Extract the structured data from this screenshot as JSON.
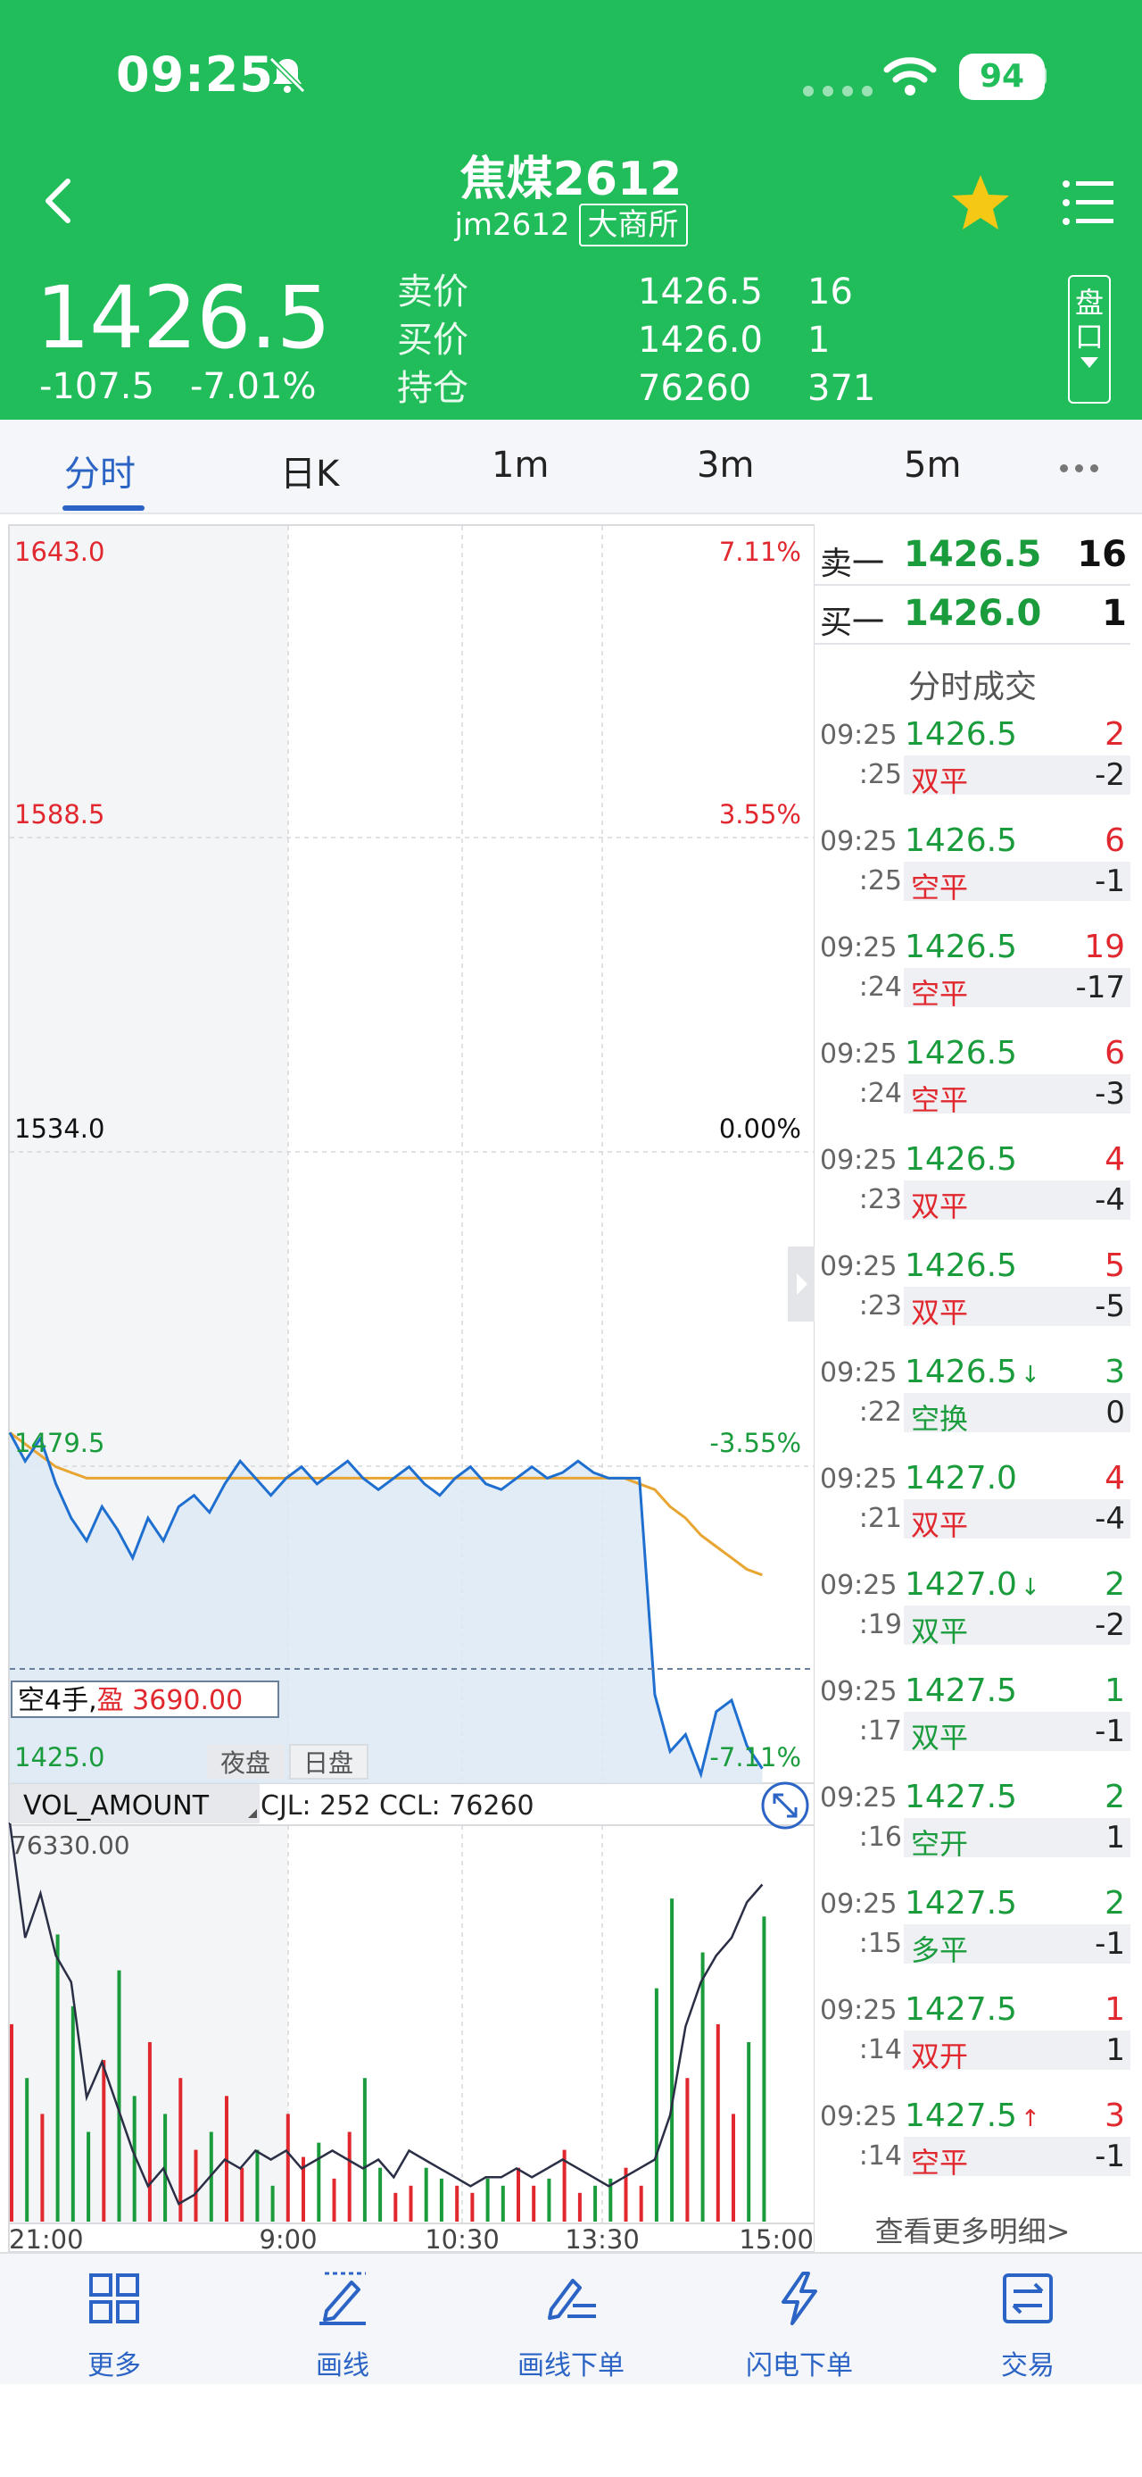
{
  "status_bar": {
    "time": "09:25",
    "battery": "94"
  },
  "header": {
    "name": "焦煤2612",
    "code": "jm2612",
    "exchange": "大商所",
    "last_price": "1426.5",
    "change": "-107.5",
    "change_pct": "-7.01%",
    "quote_rows": [
      {
        "label": "卖价",
        "value": "1426.5",
        "qty": "16"
      },
      {
        "label": "买价",
        "value": "1426.0",
        "qty": "1"
      },
      {
        "label": "持仓",
        "value": "76260",
        "qty": "371"
      }
    ],
    "panel_button": "盘口"
  },
  "tabs": [
    {
      "label": "分时",
      "active": true
    },
    {
      "label": "日K",
      "active": false
    },
    {
      "label": "1m",
      "active": false
    },
    {
      "label": "3m",
      "active": false
    },
    {
      "label": "5m",
      "active": false
    }
  ],
  "chart": {
    "price_labels": [
      "1643.0",
      "1588.5",
      "1534.0",
      "1479.5",
      "1425.0"
    ],
    "pct_labels": [
      "7.11%",
      "3.55%",
      "0.00%",
      "-3.55%",
      "-7.11%"
    ],
    "position_tag_left": "空4手,",
    "position_tag_right": "盈 3690.00",
    "session_night": "夜盘",
    "session_day": "日盘",
    "vol_indicator": "VOL_AMOUNT",
    "vol_info": "CJL: 252  CCL: 76260",
    "vol_max": "76330.00",
    "x_labels": [
      "21:00",
      "9:00",
      "10:30",
      "13:30",
      "15:00"
    ],
    "colors": {
      "price_line": "#1f6fd0",
      "avg_line": "#e8a532",
      "up": "#e0282e",
      "down": "#1a9c3d"
    }
  },
  "chart_data": {
    "type": "line",
    "title": "",
    "xlabel": "",
    "ylabel": "",
    "x_ticks": [
      "21:00",
      "9:00",
      "10:30",
      "13:30",
      "15:00"
    ],
    "ylim": [
      1425.0,
      1643.0
    ],
    "pct_range": [
      "-7.11%",
      "7.11%"
    ],
    "prev_settle": 1534.0,
    "series": [
      {
        "values": [
          1485,
          1480,
          1484,
          1476,
          1470,
          1466,
          1472,
          1468,
          1463,
          1470,
          1466,
          1472,
          1474,
          1471,
          1476,
          1480,
          1477,
          1474,
          1477,
          1479,
          1476,
          1478,
          1480,
          1477,
          1475,
          1477,
          1479,
          1476,
          1474,
          1477,
          1479,
          1476,
          1475,
          1477,
          1479,
          1477,
          1478,
          1480,
          1478,
          1477,
          1477,
          1477,
          1439,
          1429,
          1432,
          1425,
          1436,
          1438,
          1430,
          1426
        ]
      },
      {
        "values": [
          1485,
          1483,
          1481,
          1479,
          1478,
          1477,
          1477,
          1477,
          1477,
          1477,
          1477,
          1477,
          1477,
          1477,
          1477,
          1477,
          1477,
          1477,
          1477,
          1477,
          1477,
          1477,
          1477,
          1477,
          1477,
          1477,
          1477,
          1477,
          1477,
          1477,
          1477,
          1477,
          1477,
          1477,
          1477,
          1477,
          1477,
          1477,
          1477,
          1477,
          1477,
          1476,
          1475,
          1472,
          1470,
          1467,
          1465,
          1463,
          1461,
          1460
        ]
      }
    ],
    "volume": [
      55,
      40,
      30,
      80,
      60,
      25,
      45,
      70,
      35,
      50,
      30,
      40,
      20,
      25,
      35,
      15,
      20,
      10,
      30,
      18,
      22,
      12,
      25,
      40,
      15,
      8,
      10,
      15,
      12,
      10,
      8,
      12,
      10,
      15,
      10,
      12,
      20,
      8,
      10,
      12,
      15,
      10,
      65,
      90,
      40,
      75,
      55,
      30,
      50,
      85
    ],
    "open_interest": [
      76330,
      76200,
      76250,
      76180,
      76150,
      76020,
      76060,
      76010,
      75960,
      75920,
      75940,
      75900,
      75910,
      75930,
      75950,
      75940,
      75960,
      75950,
      75960,
      75940,
      75950,
      75960,
      75950,
      75940,
      75950,
      75930,
      75960,
      75950,
      75940,
      75930,
      75920,
      75930,
      75930,
      75940,
      75930,
      75940,
      75950,
      75940,
      75930,
      75920,
      75930,
      75940,
      75950,
      76000,
      76100,
      76150,
      76180,
      76200,
      76240,
      76260
    ],
    "position_line": 1443.5
  },
  "order_book": [
    {
      "label": "卖一",
      "price": "1426.5",
      "vol": "16"
    },
    {
      "label": "买一",
      "price": "1426.0",
      "vol": "1"
    }
  ],
  "trades_title": "分时成交",
  "trades": [
    {
      "t1": "09:25",
      "t2": ":25",
      "price": "1426.5",
      "arrow": "",
      "vol": "2",
      "vol_color": "red",
      "type": "双平",
      "type_color": "red",
      "chg": "-2"
    },
    {
      "t1": "09:25",
      "t2": ":25",
      "price": "1426.5",
      "arrow": "",
      "vol": "6",
      "vol_color": "red",
      "type": "空平",
      "type_color": "red",
      "chg": "-1"
    },
    {
      "t1": "09:25",
      "t2": ":24",
      "price": "1426.5",
      "arrow": "",
      "vol": "19",
      "vol_color": "red",
      "type": "空平",
      "type_color": "red",
      "chg": "-17"
    },
    {
      "t1": "09:25",
      "t2": ":24",
      "price": "1426.5",
      "arrow": "",
      "vol": "6",
      "vol_color": "red",
      "type": "空平",
      "type_color": "red",
      "chg": "-3"
    },
    {
      "t1": "09:25",
      "t2": ":23",
      "price": "1426.5",
      "arrow": "",
      "vol": "4",
      "vol_color": "red",
      "type": "双平",
      "type_color": "red",
      "chg": "-4"
    },
    {
      "t1": "09:25",
      "t2": ":23",
      "price": "1426.5",
      "arrow": "",
      "vol": "5",
      "vol_color": "red",
      "type": "双平",
      "type_color": "red",
      "chg": "-5"
    },
    {
      "t1": "09:25",
      "t2": ":22",
      "price": "1426.5",
      "arrow": "↓",
      "vol": "3",
      "vol_color": "green",
      "type": "空换",
      "type_color": "green",
      "chg": "0"
    },
    {
      "t1": "09:25",
      "t2": ":21",
      "price": "1427.0",
      "arrow": "",
      "vol": "4",
      "vol_color": "red",
      "type": "双平",
      "type_color": "red",
      "chg": "-4"
    },
    {
      "t1": "09:25",
      "t2": ":19",
      "price": "1427.0",
      "arrow": "↓",
      "vol": "2",
      "vol_color": "green",
      "type": "双平",
      "type_color": "green",
      "chg": "-2"
    },
    {
      "t1": "09:25",
      "t2": ":17",
      "price": "1427.5",
      "arrow": "",
      "vol": "1",
      "vol_color": "green",
      "type": "双平",
      "type_color": "green",
      "chg": "-1"
    },
    {
      "t1": "09:25",
      "t2": ":16",
      "price": "1427.5",
      "arrow": "",
      "vol": "2",
      "vol_color": "green",
      "type": "空开",
      "type_color": "green",
      "chg": "1"
    },
    {
      "t1": "09:25",
      "t2": ":15",
      "price": "1427.5",
      "arrow": "",
      "vol": "2",
      "vol_color": "green",
      "type": "多平",
      "type_color": "green",
      "chg": "-1"
    },
    {
      "t1": "09:25",
      "t2": ":14",
      "price": "1427.5",
      "arrow": "",
      "vol": "1",
      "vol_color": "red",
      "type": "双开",
      "type_color": "red",
      "chg": "1"
    },
    {
      "t1": "09:25",
      "t2": ":14",
      "price": "1427.5",
      "arrow": "↑",
      "vol": "3",
      "vol_color": "red",
      "type": "空平",
      "type_color": "red",
      "chg": "-1"
    }
  ],
  "more_details": "查看更多明细>",
  "bottom_nav": [
    {
      "label": "更多",
      "icon": "grid-icon"
    },
    {
      "label": "画线",
      "icon": "draw-line-icon"
    },
    {
      "label": "画线下单",
      "icon": "draw-order-icon"
    },
    {
      "label": "闪电下单",
      "icon": "lightning-icon"
    },
    {
      "label": "交易",
      "icon": "trade-icon"
    }
  ]
}
